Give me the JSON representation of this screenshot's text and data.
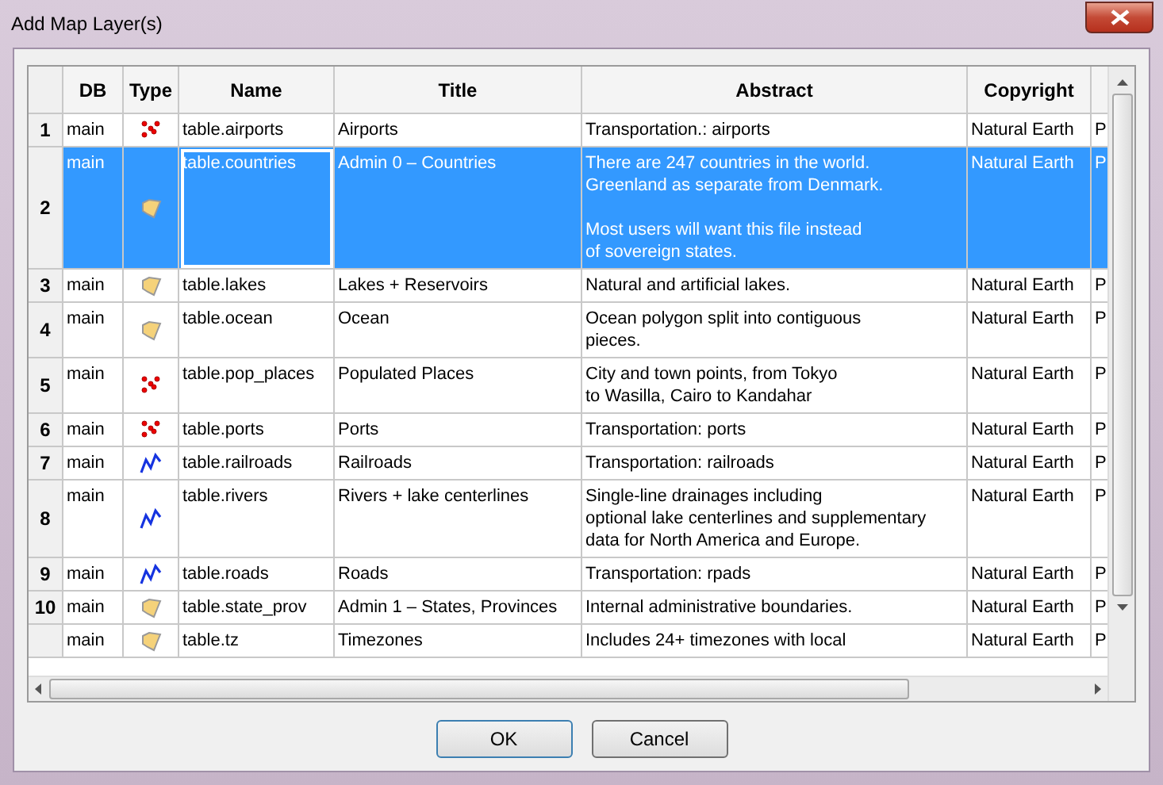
{
  "window": {
    "title": "Add Map Layer(s)"
  },
  "table": {
    "columns": [
      "DB",
      "Type",
      "Name",
      "Title",
      "Abstract",
      "Copyright"
    ],
    "rows": [
      {
        "number": "1",
        "db": "main",
        "type": {
          "kind": "point"
        },
        "name": "table.airports",
        "title": "Airports",
        "abstract": "Transportation.: airports",
        "copyright": "Natural Earth",
        "column_7": "P",
        "selected": false
      },
      {
        "number": "2",
        "db": "main",
        "type": {
          "kind": "polygon"
        },
        "name": "table.countries",
        "title": "Admin 0 – Countries",
        "abstract": "There are 247 countries in the world.\nGreenland as separate from Denmark.\n\nMost users will want this file instead\nof sovereign states.",
        "copyright": "Natural Earth",
        "column_7": "P",
        "selected": true
      },
      {
        "number": "3",
        "db": "main",
        "type": {
          "kind": "polygon"
        },
        "name": "table.lakes",
        "title": "Lakes + Reservoirs",
        "abstract": "Natural and artificial lakes.",
        "copyright": "Natural Earth",
        "column_7": "P",
        "selected": false
      },
      {
        "number": "4",
        "db": "main",
        "type": {
          "kind": "polygon"
        },
        "name": "table.ocean",
        "title": "Ocean",
        "abstract": "Ocean polygon split into contiguous\npieces.",
        "copyright": "Natural Earth",
        "column_7": "P",
        "selected": false
      },
      {
        "number": "5",
        "db": "main",
        "type": {
          "kind": "point"
        },
        "name": "table.pop_places",
        "title": "Populated Places",
        "abstract": "City and town points, from Tokyo\nto Wasilla, Cairo to Kandahar",
        "copyright": "Natural Earth",
        "column_7": "P",
        "selected": false
      },
      {
        "number": "6",
        "db": "main",
        "type": {
          "kind": "point"
        },
        "name": "table.ports",
        "title": "Ports",
        "abstract": "Transportation: ports",
        "copyright": "Natural Earth",
        "column_7": "P",
        "selected": false
      },
      {
        "number": "7",
        "db": "main",
        "type": {
          "kind": "line"
        },
        "name": "table.railroads",
        "title": "Railroads",
        "abstract": "Transportation: railroads",
        "copyright": "Natural Earth",
        "column_7": "P",
        "selected": false
      },
      {
        "number": "8",
        "db": "main",
        "type": {
          "kind": "line"
        },
        "name": "table.rivers",
        "title": "Rivers + lake centerlines",
        "abstract": "Single-line drainages including\noptional lake centerlines and supplementary\ndata for North America and Europe.",
        "copyright": "Natural Earth",
        "column_7": "P",
        "selected": false
      },
      {
        "number": "9",
        "db": "main",
        "type": {
          "kind": "line"
        },
        "name": "table.roads",
        "title": "Roads",
        "abstract": "Transportation: rpads",
        "copyright": "Natural Earth",
        "column_7": "P",
        "selected": false
      },
      {
        "number": "10",
        "db": "main",
        "type": {
          "kind": "polygon"
        },
        "name": "table.state_prov",
        "title": "Admin 1 – States, Provinces",
        "abstract": "Internal administrative boundaries.",
        "copyright": "Natural Earth",
        "column_7": "P",
        "selected": false
      },
      {
        "db": "main",
        "type": {
          "kind": "polygon"
        },
        "name": "table.tz",
        "title": "Timezones",
        "abstract": "Includes 24+ timezones with local",
        "copyright": "Natural Earth",
        "column_7": "P",
        "selected": false
      }
    ]
  },
  "buttons": [
    "OK",
    "Cancel"
  ]
}
